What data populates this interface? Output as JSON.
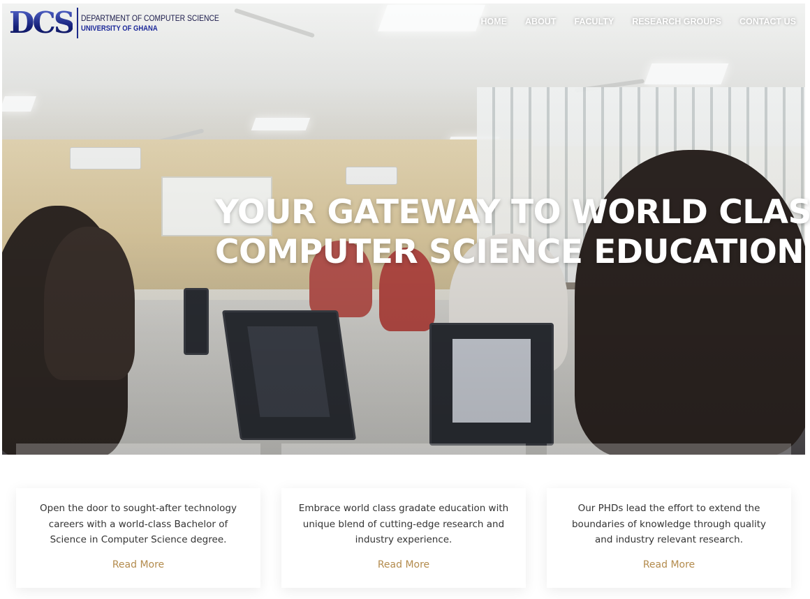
{
  "logo": {
    "mark": "DCS",
    "line1": "DEPARTMENT OF COMPUTER SCIENCE",
    "line2": "UNIVERSITY OF GHANA"
  },
  "nav": {
    "items": [
      {
        "label": "HOME"
      },
      {
        "label": "ABOUT"
      },
      {
        "label": "FACULTY"
      },
      {
        "label": "RESEARCH GROUPS"
      },
      {
        "label": "CONTACT US"
      }
    ]
  },
  "hero": {
    "headline_line1": "YOUR GATEWAY TO WORLD CLASS",
    "headline_line2": "COMPUTER SCIENCE EDUCATION"
  },
  "cards": [
    {
      "text": "Open the door to sought-after technology careers with a world-class Bachelor of Science in Computer Science degree.",
      "link": "Read More"
    },
    {
      "text": "Embrace world class gradate education with unique blend of cutting-edge research and industry experience.",
      "link": "Read More"
    },
    {
      "text": "Our PHDs lead the effort to extend the boundaries of knowledge through quality and industry relevant research.",
      "link": "Read More"
    }
  ],
  "colors": {
    "accent_link": "#b38b4d",
    "logo_blue": "#1d2a8a",
    "nav_text": "#ffffff"
  }
}
